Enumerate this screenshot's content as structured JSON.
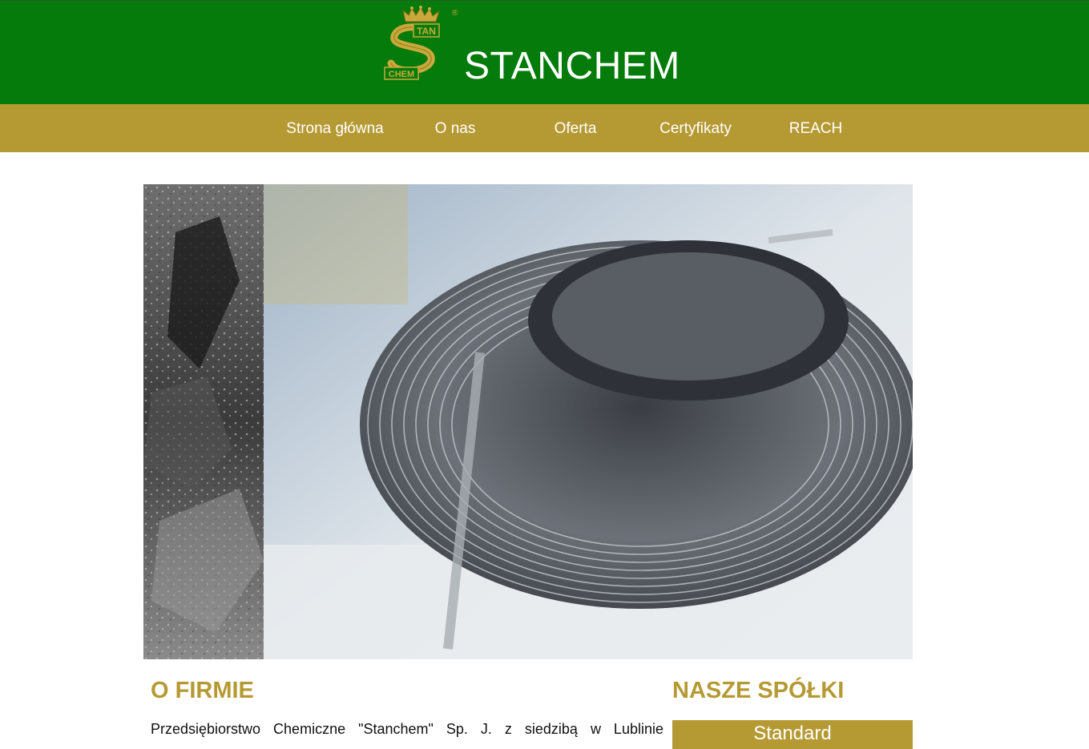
{
  "header": {
    "brand": "STANCHEM",
    "logo_text_top": "TAN",
    "logo_text_bottom": "CHEM",
    "logo_registered": "®"
  },
  "nav": {
    "items": [
      {
        "label": "Strona główna"
      },
      {
        "label": "O nas"
      },
      {
        "label": "Oferta"
      },
      {
        "label": "Certyfikaty"
      },
      {
        "label": "REACH"
      }
    ]
  },
  "hero": {
    "image_left": "coal-rock-photo",
    "image_main": "steel-wire-coil-photo"
  },
  "about": {
    "heading": "O FIRMIE",
    "text": "Przedsiębiorstwo Chemiczne \"Stanchem\" Sp. J. z siedzibą w Lublinie"
  },
  "companies": {
    "heading": "NASZE SPÓŁKI",
    "items": [
      {
        "label": "Standard"
      }
    ]
  },
  "colors": {
    "header_green": "#047b0a",
    "gold": "#b59a34",
    "text": "#111111"
  }
}
